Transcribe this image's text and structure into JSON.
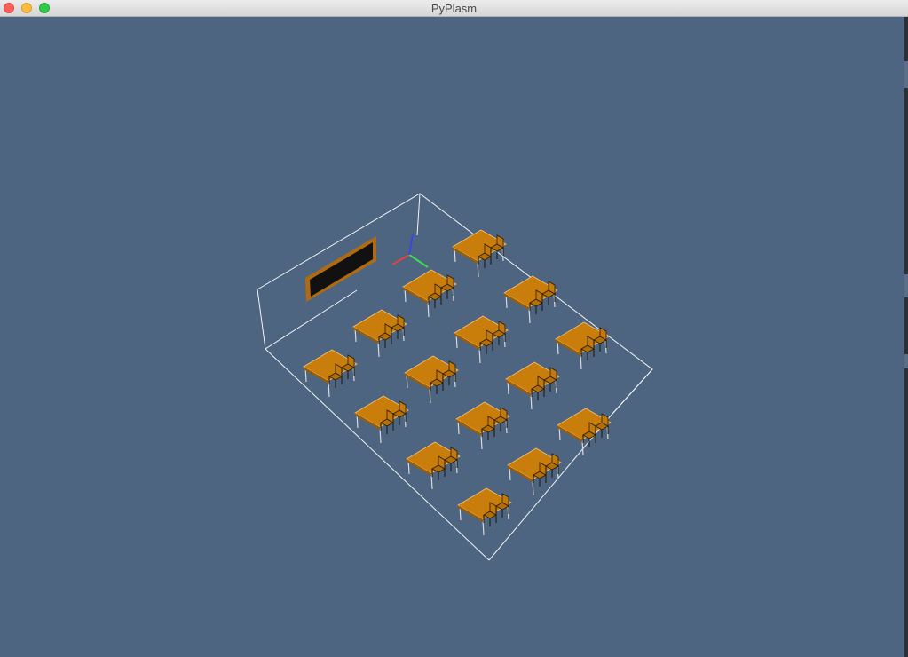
{
  "window": {
    "title": "PyPlasm",
    "controls": {
      "close": "close-button",
      "minimize": "minimize-button",
      "zoom": "zoom-button"
    }
  },
  "scene": {
    "background_color": "#4d6580",
    "desk_color": "#c97d0a",
    "desk_edge_color": "#f1c27a",
    "room_outline_color": "#f2f4f6",
    "blackboard_color": "#111111",
    "blackboard_frame_color": "#b06a12",
    "axis_colors": {
      "x": "#e8423a",
      "y": "#3ddc54",
      "z": "#3a46e8"
    },
    "desk_rows": 4,
    "desk_columns": 4,
    "desk_count": 15
  }
}
